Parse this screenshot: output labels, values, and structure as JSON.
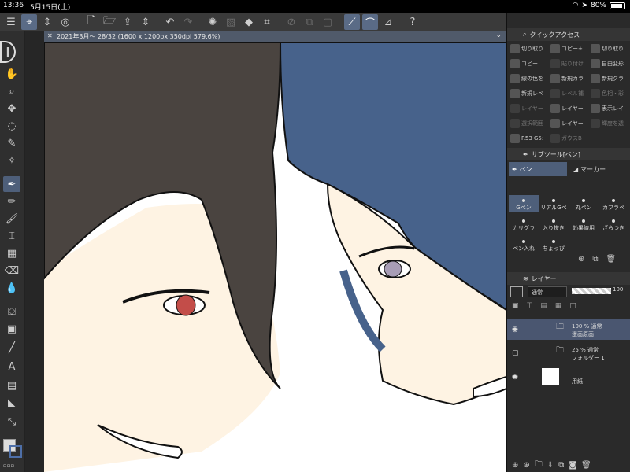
{
  "status": {
    "time": "13:36",
    "date": "5月15日(土)",
    "battery": "80%"
  },
  "document_tab": {
    "title": "2021年3月～ 28/32 (1600 x 1200px 350dpi 579.6%)"
  },
  "quick_access": {
    "title": "クイックアクセス",
    "items": [
      {
        "label": "切り取り",
        "dim": false
      },
      {
        "label": "コピー+",
        "dim": false
      },
      {
        "label": "切り取り",
        "dim": false
      },
      {
        "label": "コピー",
        "dim": false
      },
      {
        "label": "貼り付け",
        "dim": true
      },
      {
        "label": "自由変形",
        "dim": false
      },
      {
        "label": "線の色を",
        "dim": false
      },
      {
        "label": "新規カラ",
        "dim": false
      },
      {
        "label": "新規グラ",
        "dim": false
      },
      {
        "label": "新規レベ",
        "dim": false
      },
      {
        "label": "レベル補",
        "dim": true
      },
      {
        "label": "色相・彩",
        "dim": true
      },
      {
        "label": "レイヤー",
        "dim": true
      },
      {
        "label": "レイヤー",
        "dim": false
      },
      {
        "label": "表示レイ",
        "dim": false
      },
      {
        "label": "選択範囲",
        "dim": true
      },
      {
        "label": "レイヤー",
        "dim": false
      },
      {
        "label": "輝度を透",
        "dim": true
      },
      {
        "label": "R53 G5:",
        "dim": false
      },
      {
        "label": "ガウスB",
        "dim": true
      }
    ]
  },
  "subtool": {
    "title": "サブツール[ペン]",
    "tabs": [
      "ペン",
      "マーカー"
    ],
    "brushes": [
      {
        "label": "Gペン",
        "selected": true
      },
      {
        "label": "リアルGペ",
        "selected": false
      },
      {
        "label": "丸ペン",
        "selected": false
      },
      {
        "label": "カブラペ",
        "selected": false
      },
      {
        "label": "カリグラ",
        "selected": false
      },
      {
        "label": "入り抜き",
        "selected": false
      },
      {
        "label": "効果線用",
        "selected": false
      },
      {
        "label": "ざらつき",
        "selected": false
      },
      {
        "label": "ペン入れ",
        "selected": false
      },
      {
        "label": "ちょっぴ",
        "selected": false
      }
    ]
  },
  "layers": {
    "title": "レイヤー",
    "blend_mode": "通常",
    "opacity": "100",
    "rows": [
      {
        "line1": "100 % 通常",
        "line2": "漫画原画",
        "selected": true,
        "visible": true
      },
      {
        "line1": "25 % 通常",
        "line2": "フォルダー 1",
        "selected": false,
        "visible": false
      },
      {
        "line1": "",
        "line2": "用紙",
        "selected": false,
        "visible": true
      }
    ]
  },
  "icons": {
    "menu": "menu-icon",
    "undo": "undo-icon",
    "redo": "redo-icon",
    "eye": "eye-icon"
  },
  "colors": {
    "hair_dark": "#4a4440",
    "hair_blue": "#47628b",
    "skin": "#fef3e3",
    "eye_red": "#c34d49",
    "eye_lilac": "#a89db6"
  }
}
